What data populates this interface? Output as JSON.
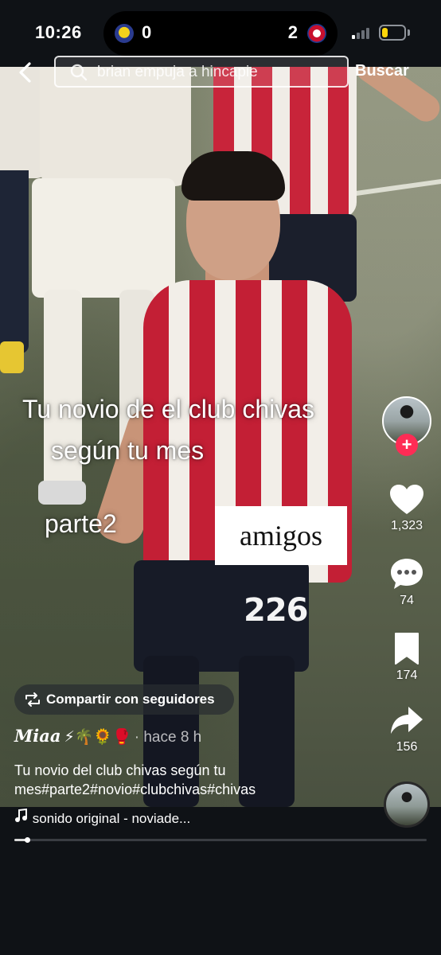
{
  "status_bar": {
    "time": "10:26",
    "live_activity": {
      "home_team_icon": "club-america-logo",
      "home_score": "0",
      "away_score": "2",
      "away_team_icon": "chivas-logo"
    },
    "battery_color": "#ffd60a",
    "battery_level": 0.25
  },
  "search": {
    "query": "brian empuja a hincapie",
    "button_label": "Buscar"
  },
  "video_overlay": {
    "caption_line1": "Tu novio de el club chivas",
    "caption_line2": "según tu mes",
    "caption_line3": "parte2",
    "label_box": "amigos",
    "jersey_number": "226"
  },
  "actions": {
    "like_count": "1,323",
    "comment_count": "74",
    "bookmark_count": "174",
    "share_count": "156",
    "follow_symbol": "+",
    "follow_color": "#fe2c55"
  },
  "post": {
    "share_chip_label": "Compartir con seguidores",
    "username": "𝑴𝒊𝒂𝒂",
    "username_emojis": "⚡🌴🌻🥊",
    "time_ago": "· hace 8 h",
    "description": "Tu novio del club chivas según tu mes#parte2#novio#clubchivas#chivas",
    "sound": "sonido original - noviade...",
    "progress": 0.03
  }
}
